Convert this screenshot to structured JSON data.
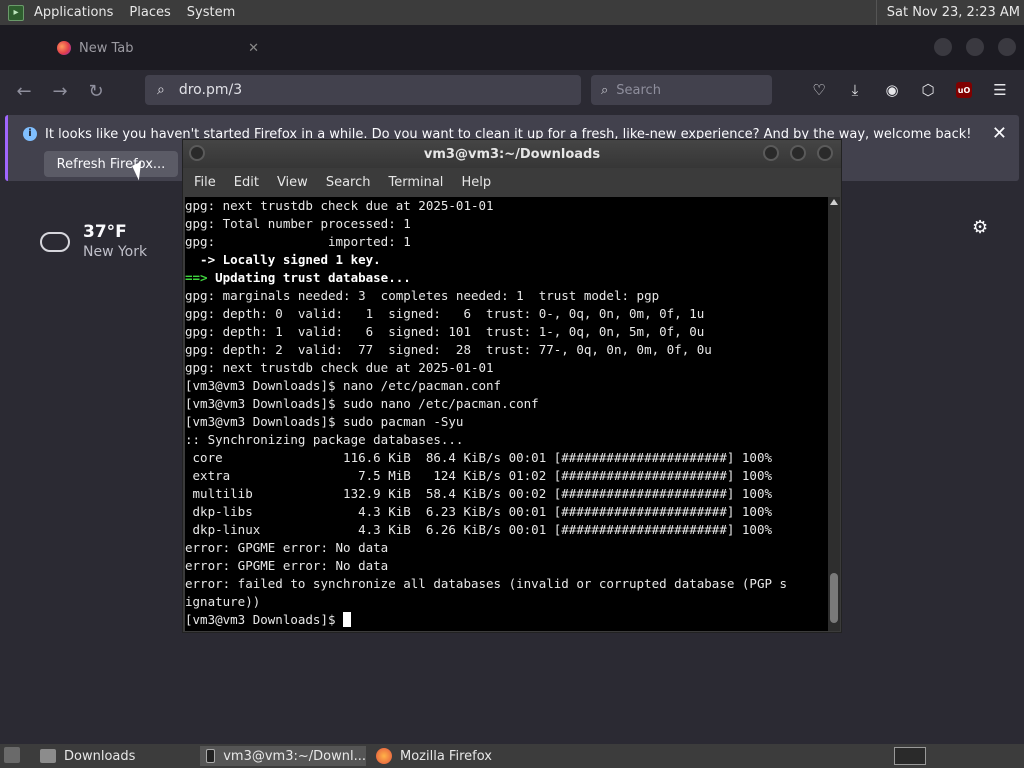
{
  "top_panel": {
    "menus": [
      "Applications",
      "Places",
      "System"
    ],
    "clock": "Sat Nov 23,  2:23 AM"
  },
  "firefox": {
    "tab_title": "New Tab",
    "url": "dro.pm/3",
    "search_placeholder": "Search",
    "notification": {
      "message": "It looks like you haven't started Firefox in a while. Do you want to clean it up for a fresh, like-new experience? And by the way, welcome back!",
      "button": "Refresh Firefox..."
    },
    "weather": {
      "temp": "37°F",
      "city": "New York"
    },
    "ublock_label": "uO"
  },
  "terminal": {
    "title": "vm3@vm3:~/Downloads",
    "menu": [
      "File",
      "Edit",
      "View",
      "Search",
      "Terminal",
      "Help"
    ],
    "lines": [
      {
        "text": "gpg: next trustdb check due at 2025-01-01",
        "style": ""
      },
      {
        "text": "gpg: Total number processed: 1",
        "style": ""
      },
      {
        "text": "gpg:               imported: 1",
        "style": ""
      },
      {
        "text": "  -> Locally signed 1 key.",
        "style": "bold"
      },
      {
        "text": "==> Updating trust database...",
        "style": "green-prefix"
      },
      {
        "text": "gpg: marginals needed: 3  completes needed: 1  trust model: pgp",
        "style": ""
      },
      {
        "text": "gpg: depth: 0  valid:   1  signed:   6  trust: 0-, 0q, 0n, 0m, 0f, 1u",
        "style": ""
      },
      {
        "text": "gpg: depth: 1  valid:   6  signed: 101  trust: 1-, 0q, 0n, 5m, 0f, 0u",
        "style": ""
      },
      {
        "text": "gpg: depth: 2  valid:  77  signed:  28  trust: 77-, 0q, 0n, 0m, 0f, 0u",
        "style": ""
      },
      {
        "text": "gpg: next trustdb check due at 2025-01-01",
        "style": ""
      },
      {
        "text": "[vm3@vm3 Downloads]$ nano /etc/pacman.conf",
        "style": ""
      },
      {
        "text": "[vm3@vm3 Downloads]$ sudo nano /etc/pacman.conf",
        "style": ""
      },
      {
        "text": "[vm3@vm3 Downloads]$ sudo pacman -Syu",
        "style": ""
      },
      {
        "text": ":: Synchronizing package databases...",
        "style": ""
      },
      {
        "text": " core                116.6 KiB  86.4 KiB/s 00:01 [######################] 100%",
        "style": ""
      },
      {
        "text": " extra                 7.5 MiB   124 KiB/s 01:02 [######################] 100%",
        "style": ""
      },
      {
        "text": " multilib            132.9 KiB  58.4 KiB/s 00:02 [######################] 100%",
        "style": ""
      },
      {
        "text": " dkp-libs              4.3 KiB  6.23 KiB/s 00:01 [######################] 100%",
        "style": ""
      },
      {
        "text": " dkp-linux             4.3 KiB  6.26 KiB/s 00:01 [######################] 100%",
        "style": ""
      },
      {
        "text": "error: GPGME error: No data",
        "style": ""
      },
      {
        "text": "error: GPGME error: No data",
        "style": ""
      },
      {
        "text": "error: failed to synchronize all databases (invalid or corrupted database (PGP s",
        "style": ""
      },
      {
        "text": "ignature))",
        "style": ""
      }
    ],
    "prompt": "[vm3@vm3 Downloads]$ "
  },
  "taskbar": {
    "items": [
      "Downloads",
      "vm3@vm3:~/Downl...",
      "Mozilla Firefox"
    ]
  },
  "colors": {
    "firefox_bg": "#2b2a33",
    "notice_accent": "#a066ff",
    "terminal_bg": "#000000",
    "arrow_green": "#3fd43f"
  }
}
